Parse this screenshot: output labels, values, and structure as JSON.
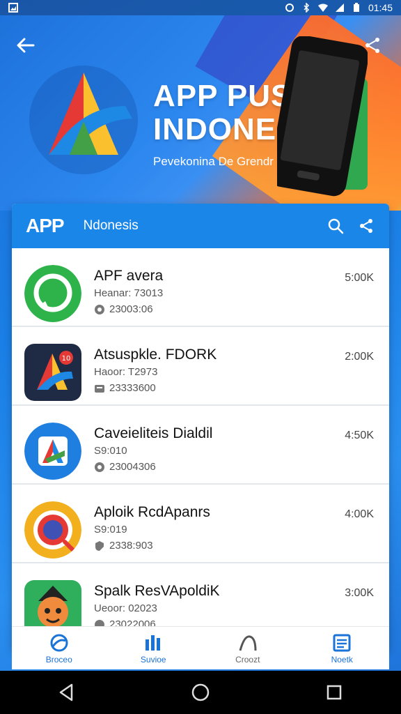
{
  "status_bar": {
    "time": "01:45",
    "icons": [
      "image-icon",
      "alarm-icon",
      "bluetooth-icon",
      "wifi-icon",
      "signal-icon",
      "battery-icon"
    ]
  },
  "hero": {
    "title_line1": "APP PUSAN",
    "title_line2": "INDONESIA",
    "subtitle": "Pevekonina De Grendr"
  },
  "card_bar": {
    "logo": "APP",
    "tab": "Ndonesis"
  },
  "apps": [
    {
      "name": "APF avera",
      "sub": "Heanar: 73013",
      "stat": "23003:06",
      "size": "5:00K",
      "icon": "green-chat-icon",
      "color": "#2db34a"
    },
    {
      "name": "Atsuspkle. FDORK",
      "sub": "Haoor: T2973",
      "stat": "23333600",
      "size": "2:00K",
      "icon": "play-a-icon",
      "color": "#1f2a44"
    },
    {
      "name": "Caveieliteis Dialdil",
      "sub": "S9:010",
      "stat": "23004306",
      "size": "4:50K",
      "icon": "blue-a-icon",
      "color": "#1f7fe0"
    },
    {
      "name": "Aploik RcdApanrs",
      "sub": "S9:019",
      "stat": "2338:903",
      "size": "4:00K",
      "icon": "target-icon",
      "color": "#f2b01e"
    },
    {
      "name": "Spalk ResVApoldiK",
      "sub": "Ueoor: 02023",
      "stat": "23022006",
      "size": "3:00K",
      "icon": "fox-character-icon",
      "color": "#2fae5b"
    }
  ],
  "bottom_nav": [
    {
      "label": "Broceo",
      "icon": "swirl-icon",
      "active": true
    },
    {
      "label": "Suvioe",
      "icon": "grid-chart-icon",
      "active": true
    },
    {
      "label": "Croozt",
      "icon": "curve-icon",
      "active": false
    },
    {
      "label": "Noetk",
      "icon": "document-icon",
      "active": true
    }
  ],
  "colors": {
    "accent": "#1a86e8",
    "hero_orange": "#f46b2d"
  }
}
